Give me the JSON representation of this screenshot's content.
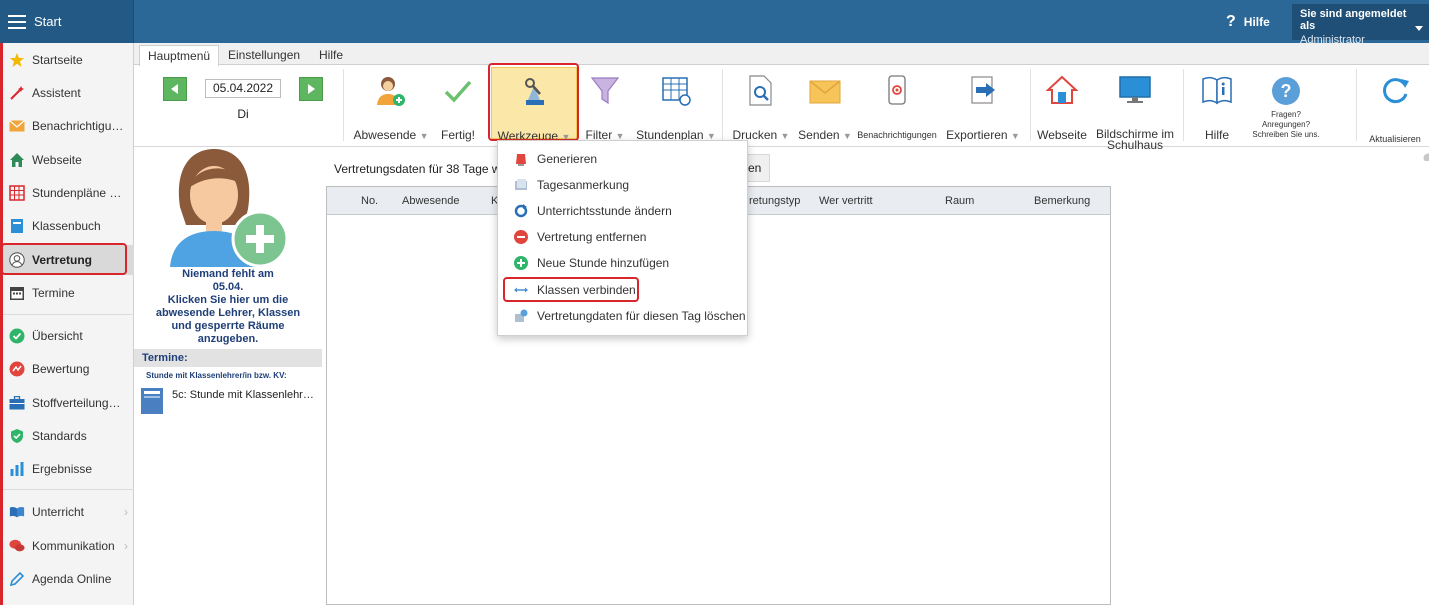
{
  "topbar": {
    "start_label": "Start",
    "help_label": "Hilfe",
    "login_line1": "Sie sind angemeldet als",
    "login_user": "Administrator"
  },
  "sidebar": {
    "items": [
      {
        "label": "Startseite",
        "icon": "star-icon"
      },
      {
        "label": "Assistent",
        "icon": "wand-icon"
      },
      {
        "label": "Benachrichtigu…",
        "icon": "envelope-icon"
      },
      {
        "label": "Webseite",
        "icon": "home-icon"
      },
      {
        "label": "Stundenpläne …",
        "icon": "timetable-icon"
      },
      {
        "label": "Klassenbuch",
        "icon": "book-icon"
      },
      {
        "label": "Vertretung",
        "icon": "person-icon"
      },
      {
        "label": "Termine",
        "icon": "calendar-icon"
      },
      {
        "label": "Übersicht",
        "icon": "check-circle-icon"
      },
      {
        "label": "Bewertung",
        "icon": "rating-icon"
      },
      {
        "label": "Stoffverteilung…",
        "icon": "briefcase-icon"
      },
      {
        "label": "Standards",
        "icon": "shield-icon"
      },
      {
        "label": "Ergebnisse",
        "icon": "bar-chart-icon"
      },
      {
        "label": "Unterricht",
        "icon": "open-book-icon"
      },
      {
        "label": "Kommunikation",
        "icon": "chat-icon"
      },
      {
        "label": "Agenda Online",
        "icon": "pen-icon"
      }
    ]
  },
  "ribbon": {
    "tabs": [
      "Hauptmenü",
      "Einstellungen",
      "Hilfe"
    ],
    "date": "05.04.2022",
    "weekday": "Di",
    "buttons": {
      "abwesende": "Abwesende",
      "fertig": "Fertig!",
      "werkzeuge": "Werkzeuge",
      "filter": "Filter",
      "stundenplan": "Stundenplan",
      "drucken": "Drucken",
      "senden": "Senden",
      "benachrichtigungen": "Benachrichtigungen",
      "exportieren": "Exportieren",
      "webseite": "Webseite",
      "bildschirme1": "Bildschirme im",
      "bildschirme2": "Schulhaus",
      "hilfe": "Hilfe",
      "fragen1": "Fragen?",
      "fragen2": "Anregungen?",
      "fragen3": "Schreiben Sie uns.",
      "aktualisieren": "Aktualisieren"
    },
    "dropdown_arrow": "▼"
  },
  "absent_panel": {
    "lines": [
      "Niemand fehlt am",
      "05.04.",
      "Klicken Sie hier um die",
      "abwesende Lehrer, Klassen",
      "und gesperrte Räume",
      "anzugeben."
    ],
    "termine_header": "Termine:",
    "termine_sub": "Stunde mit Klassenlehrer/in bzw. KV:",
    "termine_item": "5c: Stunde mit Klassenlehr…"
  },
  "main": {
    "status_text": "Vertretungsdaten für 38 Tage wu",
    "status_button_tail": "en",
    "columns": {
      "no": "No.",
      "abwesende": "Abwesende",
      "k": "K",
      "typ": "retungstyp",
      "wer": "Wer vertritt",
      "raum": "Raum",
      "bemerkung": "Bemerkung"
    }
  },
  "tools_menu": {
    "items": [
      {
        "label": "Generieren",
        "icon": "generate-icon"
      },
      {
        "label": "Tagesanmerkung",
        "icon": "note-icon"
      },
      {
        "label": "Unterrichtsstunde ändern",
        "icon": "refresh-icon"
      },
      {
        "label": "Vertretung entfernen",
        "icon": "minus-circle-icon"
      },
      {
        "label": "Neue Stunde hinzufügen",
        "icon": "plus-circle-icon"
      },
      {
        "label": "Klassen verbinden",
        "icon": "link-arrows-icon"
      },
      {
        "label": "Vertretungdaten für diesen Tag löschen",
        "icon": "erase-icon"
      }
    ]
  }
}
